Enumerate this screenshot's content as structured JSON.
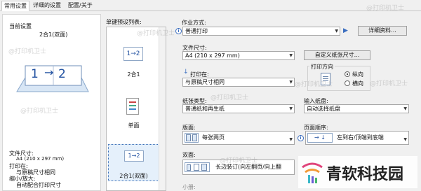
{
  "tabs": [
    {
      "label": "常用设置",
      "active": true
    },
    {
      "label": "详细的设置",
      "active": false
    },
    {
      "label": "配置/关于",
      "active": false
    }
  ],
  "preview": {
    "title": "当前设置",
    "subtitle": "2合1(双面)",
    "page_labels": [
      "1",
      "2"
    ],
    "summary": {
      "paper_size_label": "文件尺寸:",
      "paper_size_value": "A4 (210 x 297 mm)",
      "print_on_label": "打印在:",
      "print_on_value": "与原稿尺寸相同",
      "scale_label": "缩小/放大:",
      "scale_value": "自动配合打印尺寸"
    }
  },
  "presets": {
    "label": "单键预设列表:",
    "items": [
      {
        "label": "",
        "icon": "1→2"
      },
      {
        "label": "2合1",
        "icon": ""
      },
      {
        "label": "单面",
        "icon": ""
      },
      {
        "label": "2合1(双面)",
        "icon": "1→2",
        "selected": true
      }
    ]
  },
  "job": {
    "label": "作业方式:",
    "value": "普通打印",
    "details_button": "详细资料..."
  },
  "paper_size": {
    "label": "文件尺寸:",
    "value": "A4 (210 x 297 mm)",
    "custom_button": "自定义纸张尺寸..."
  },
  "print_on": {
    "label": "打印在:",
    "value": "与原稿尺寸相同"
  },
  "orientation": {
    "label": "打印方向",
    "options": [
      {
        "label": "纵向",
        "selected": true
      },
      {
        "label": "横向",
        "selected": false
      }
    ]
  },
  "paper_type": {
    "label": "纸张类型:",
    "value": "普通纸和再生纸"
  },
  "input_tray": {
    "label": "输入纸盘:",
    "value": "自动选择纸盘"
  },
  "layout": {
    "label": "版面:",
    "value": "每张两页"
  },
  "page_order": {
    "label": "页面顺序:",
    "value": "左到右/顶端到底端"
  },
  "duplex": {
    "label": "双面:",
    "value": "长边装订(向左翻页/向上翻"
  },
  "booklet": {
    "label": "小册:"
  },
  "watermark": {
    "text": "@打印机卫士"
  },
  "brand": {
    "name": "青软科技园"
  },
  "colors": {
    "accent": "#3a6dbf",
    "selection": "#e5f0fb",
    "window_bg": "#f0f0f0"
  }
}
